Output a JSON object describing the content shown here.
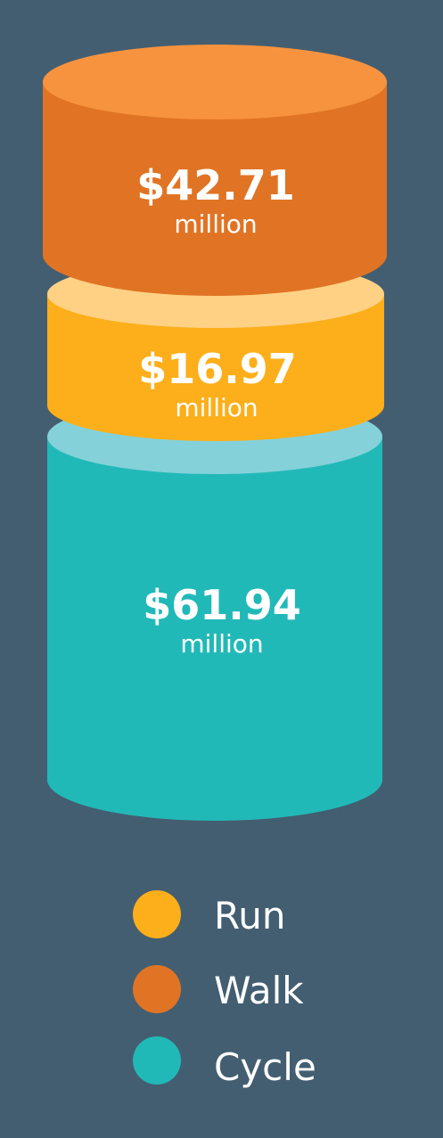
{
  "background": "#435e71",
  "chart_data": {
    "type": "bar",
    "layout": "stacked-cylinder",
    "unit": "million",
    "categories": [
      "Walk",
      "Run",
      "Cycle"
    ],
    "values": [
      42.71,
      16.97,
      61.94
    ],
    "value_labels": [
      "$42.71",
      "$16.97",
      "$61.94"
    ],
    "unit_labels": [
      "million",
      "million",
      "million"
    ],
    "colors": {
      "Walk": {
        "side": "#e07424",
        "top": "#f7933e"
      },
      "Run": {
        "side": "#fcaf1a",
        "top": "#ffd185"
      },
      "Cycle": {
        "side": "#21b9b8",
        "top": "#84d1da"
      }
    }
  },
  "legend": {
    "items": [
      {
        "label": "Run",
        "color": "#fcaf1a"
      },
      {
        "label": "Walk",
        "color": "#e07424"
      },
      {
        "label": "Cycle",
        "color": "#21b9b8"
      }
    ]
  }
}
